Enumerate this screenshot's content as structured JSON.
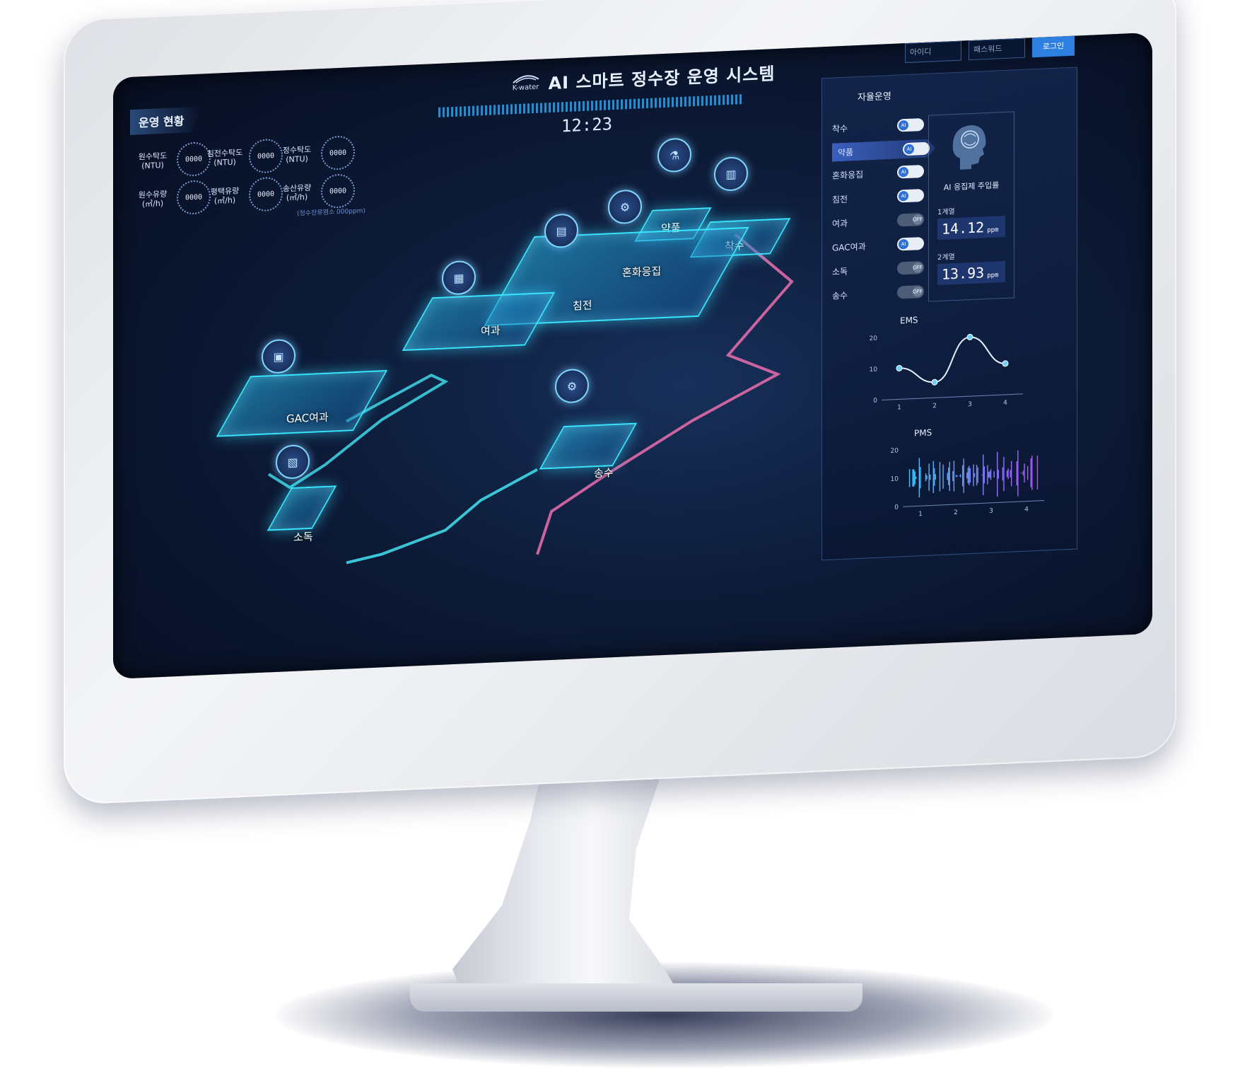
{
  "header": {
    "logo_text": "K-water",
    "title": "AI 스마트 정수장 운영 시스템",
    "time": "12:23"
  },
  "login": {
    "id_placeholder": "아이디",
    "pw_placeholder": "패스워드",
    "login_label": "로그인"
  },
  "status": {
    "title": "운영 현황",
    "gauges": [
      {
        "label": "원수탁도\n(NTU)",
        "value": "0000"
      },
      {
        "label": "침전수탁도\n(NTU)",
        "value": "0000"
      },
      {
        "label": "정수탁도\n(NTU)",
        "value": "0000"
      },
      {
        "label": "원수유량\n(㎥/h)",
        "value": "0000"
      },
      {
        "label": "평택유량\n(㎥/h)",
        "value": "0000"
      },
      {
        "label": "송산유량\n(㎥/h)",
        "value": "0000"
      }
    ],
    "note": "(정수잔류염소 000ppm)"
  },
  "map": {
    "facilities": [
      "착수",
      "약품",
      "혼화응집",
      "침전",
      "여과",
      "GAC여과",
      "송수",
      "소독"
    ]
  },
  "auto_panel": {
    "title": "자율운영",
    "rows": [
      {
        "label": "착수",
        "state": "AI"
      },
      {
        "label": "약품",
        "state": "AI"
      },
      {
        "label": "혼화응집",
        "state": "AI"
      },
      {
        "label": "침전",
        "state": "AI"
      },
      {
        "label": "여과",
        "state": "OFF"
      },
      {
        "label": "GAC여과",
        "state": "AI"
      },
      {
        "label": "소독",
        "state": "OFF"
      },
      {
        "label": "송수",
        "state": "OFF"
      }
    ],
    "ai_title": "AI 응집제 주입률",
    "series": [
      {
        "label": "1계열",
        "value": "14.12",
        "unit": "ppm"
      },
      {
        "label": "2계열",
        "value": "13.93",
        "unit": "ppm"
      }
    ]
  },
  "chart_data": [
    {
      "type": "line",
      "title": "EMS",
      "x": [
        1,
        2,
        3,
        4
      ],
      "y_ticks": [
        0,
        10,
        20
      ],
      "ylim": [
        0,
        20
      ],
      "series": [
        {
          "values": [
            10,
            5,
            19,
            10
          ]
        }
      ]
    },
    {
      "type": "bar",
      "title": "PMS",
      "x": [
        1,
        2,
        3,
        4
      ],
      "y_ticks": [
        0,
        10,
        20
      ],
      "ylim": [
        0,
        20
      ]
    }
  ],
  "colors": {
    "accent": "#39e6ff",
    "pipe_pink": "#e06aa8",
    "pipe_cyan": "#3fd8e8",
    "button": "#2d7fe0"
  }
}
